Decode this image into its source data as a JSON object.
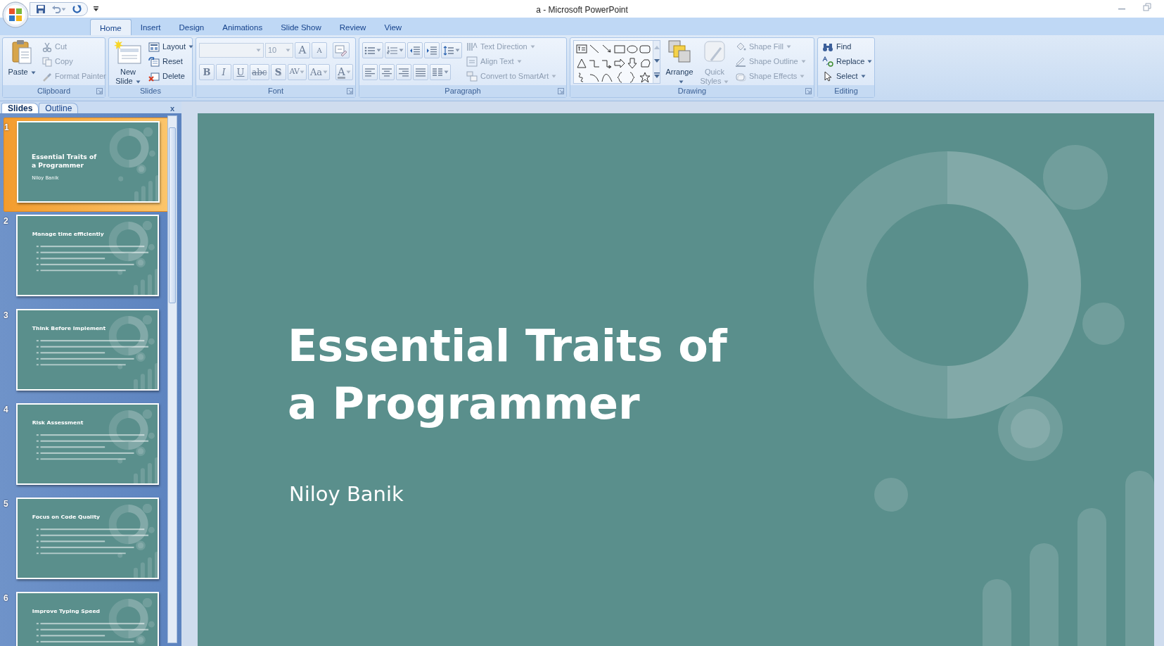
{
  "window": {
    "title": "a - Microsoft PowerPoint"
  },
  "quick_access": [
    {
      "kind": "save"
    },
    {
      "kind": "undo",
      "dropdown": true
    },
    {
      "kind": "redo"
    },
    {
      "kind": "customize"
    }
  ],
  "tabs": [
    {
      "label": "Home",
      "selected": true
    },
    {
      "label": "Insert",
      "selected": false
    },
    {
      "label": "Design",
      "selected": false
    },
    {
      "label": "Animations",
      "selected": false
    },
    {
      "label": "Slide Show",
      "selected": false
    },
    {
      "label": "Review",
      "selected": false
    },
    {
      "label": "View",
      "selected": false
    }
  ],
  "ribbon": [
    {
      "label": "Clipboard",
      "launcher": true,
      "items": [
        {
          "kind": "large",
          "label": "Paste",
          "dropdown": true,
          "disabled": false
        },
        {
          "kind": "small",
          "label": "Cut",
          "dropdown": false,
          "disabled": true
        },
        {
          "kind": "small",
          "label": "Copy",
          "dropdown": false,
          "disabled": true
        },
        {
          "kind": "small",
          "label": "Format Painter",
          "dropdown": false,
          "disabled": true
        }
      ]
    },
    {
      "label": "Slides",
      "launcher": false,
      "items": [
        {
          "kind": "large",
          "label": "New Slide",
          "dropdown": true,
          "disabled": false
        },
        {
          "kind": "small",
          "label": "Layout",
          "dropdown": true,
          "disabled": false
        },
        {
          "kind": "small",
          "label": "Reset",
          "dropdown": false,
          "disabled": false
        },
        {
          "kind": "small",
          "label": "Delete",
          "dropdown": false,
          "disabled": false
        }
      ]
    },
    {
      "label": "Font",
      "launcher": true,
      "items": [
        {
          "kind": "row",
          "buttons": [
            {
              "kind": "combo"
            },
            {
              "kind": "combo",
              "text": "10"
            },
            {
              "kind": "glyph",
              "text": "A",
              "dropdown": false
            },
            {
              "kind": "glyph",
              "text": "A",
              "dropdown": false
            },
            {
              "kind": "icon",
              "dropdown": false
            }
          ]
        },
        {
          "kind": "row",
          "buttons": [
            {
              "kind": "glyph",
              "text": "B",
              "dropdown": false
            },
            {
              "kind": "glyph",
              "text": "I",
              "dropdown": false
            },
            {
              "kind": "glyph",
              "text": "U",
              "dropdown": false
            },
            {
              "kind": "glyph",
              "text": "abc",
              "dropdown": false
            },
            {
              "kind": "glyph",
              "text": "S",
              "dropdown": false
            },
            {
              "kind": "glyph",
              "text": "AV",
              "dropdown": true
            },
            {
              "kind": "glyph",
              "text": "Aa",
              "dropdown": true
            },
            {
              "kind": "glyph",
              "text": "A",
              "dropdown": true
            }
          ]
        }
      ]
    },
    {
      "label": "Paragraph",
      "launcher": true,
      "items": [
        {
          "kind": "row",
          "buttons": [
            {
              "kind": "icon",
              "dropdown": true
            },
            {
              "kind": "icon",
              "dropdown": true
            },
            {
              "kind": "icon",
              "dropdown": false
            },
            {
              "kind": "icon",
              "dropdown": false
            },
            {
              "kind": "icon",
              "dropdown": true
            }
          ]
        },
        {
          "kind": "row",
          "buttons": [
            {
              "kind": "icon",
              "dropdown": false
            },
            {
              "kind": "icon",
              "dropdown": false
            },
            {
              "kind": "icon",
              "dropdown": false
            },
            {
              "kind": "icon",
              "dropdown": false
            },
            {
              "kind": "icon",
              "dropdown": true
            }
          ]
        },
        {
          "kind": "small",
          "label": "Text Direction",
          "dropdown": true,
          "disabled": true
        },
        {
          "kind": "small",
          "label": "Align Text",
          "dropdown": true,
          "disabled": true
        },
        {
          "kind": "small",
          "label": "Convert to SmartArt",
          "dropdown": true,
          "disabled": true
        }
      ]
    },
    {
      "label": "Drawing",
      "launcher": true,
      "items": [
        {
          "kind": "gallery"
        },
        {
          "kind": "large",
          "label": "Arrange",
          "dropdown": true,
          "disabled": false
        },
        {
          "kind": "large",
          "label": "Quick Styles",
          "dropdown": true,
          "disabled": true
        },
        {
          "kind": "small",
          "label": "Shape Fill",
          "dropdown": true,
          "disabled": true
        },
        {
          "kind": "small",
          "label": "Shape Outline",
          "dropdown": true,
          "disabled": true
        },
        {
          "kind": "small",
          "label": "Shape Effects",
          "dropdown": true,
          "disabled": true
        }
      ]
    },
    {
      "label": "Editing",
      "launcher": false,
      "items": [
        {
          "kind": "small",
          "label": "Find",
          "dropdown": false,
          "disabled": false
        },
        {
          "kind": "small",
          "label": "Replace",
          "dropdown": true,
          "disabled": false
        },
        {
          "kind": "small",
          "label": "Select",
          "dropdown": true,
          "disabled": false
        }
      ]
    }
  ],
  "pane_tabs": [
    {
      "label": "Slides",
      "selected": true
    },
    {
      "label": "Outline",
      "selected": false
    }
  ],
  "pane_close": "x",
  "slides": [
    {
      "number": "1",
      "selected": true,
      "kind": "title",
      "title_lines": [
        "Essential Traits of",
        "a Programmer"
      ],
      "subtitle": "Niloy Banik"
    },
    {
      "number": "2",
      "selected": false,
      "kind": "content",
      "title": "Manage time efficiently"
    },
    {
      "number": "3",
      "selected": false,
      "kind": "content",
      "title": "Think Before Implement"
    },
    {
      "number": "4",
      "selected": false,
      "kind": "content",
      "title": "Risk Assessment"
    },
    {
      "number": "5",
      "selected": false,
      "kind": "content",
      "title": "Focus on Code Quality"
    },
    {
      "number": "6",
      "selected": false,
      "kind": "content",
      "title": "Improve Typing Speed"
    }
  ],
  "editor_slide": {
    "kind": "title",
    "title_lines": [
      "Essential Traits of",
      "a Programmer"
    ],
    "subtitle": "Niloy Banik"
  }
}
